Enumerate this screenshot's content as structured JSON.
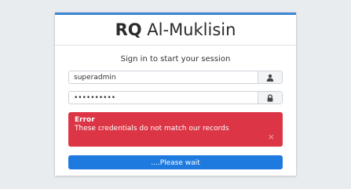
{
  "header": {
    "brand_bold": "RQ",
    "brand_rest": " Al-Muklisin"
  },
  "login": {
    "message": "Sign in to start your session",
    "username_value": "superadmin",
    "password_value": "••••••••••",
    "username_icon": "user-icon",
    "password_icon": "lock-icon"
  },
  "alert": {
    "title": "Error",
    "text": "These credentials do not match our records",
    "close_label": "×",
    "color": "#dc3545"
  },
  "submit": {
    "label": "....Please wait",
    "color": "#1f7ae0"
  },
  "colors": {
    "card_accent": "#3b86d6"
  }
}
